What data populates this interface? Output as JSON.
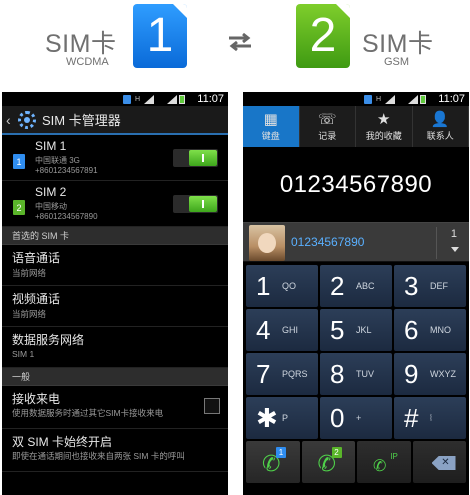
{
  "banner": {
    "left_sim": "SIM卡",
    "left_sub": "WCDMA",
    "card1": "1",
    "card2": "2",
    "right_sim": "SIM卡",
    "right_sub": "GSM"
  },
  "statusbar": {
    "time": "11:07",
    "net_label": "H"
  },
  "settings": {
    "title": "SIM 卡管理器",
    "sims": [
      {
        "badge": "1",
        "name": "SIM 1",
        "operator": "中国联通 3G",
        "number": "+8601234567891"
      },
      {
        "badge": "2",
        "name": "SIM 2",
        "operator": "中国移动",
        "number": "+8601234567890"
      }
    ],
    "preferred_header": "首选的 SIM 卡",
    "items": [
      {
        "title": "语音通话",
        "sub": "当前网络"
      },
      {
        "title": "视频通话",
        "sub": "当前网络"
      },
      {
        "title": "数据服务网络",
        "sub": "SIM 1"
      }
    ],
    "general_header": "一般",
    "receive": {
      "title": "接收来电",
      "sub": "使用数据服务时通过其它SIM卡接收来电"
    },
    "dual": {
      "title": "双 SIM 卡始终开启",
      "sub": "即使在通话期间也接收来自两张 SIM 卡的呼叫"
    }
  },
  "dialer": {
    "tabs": [
      {
        "icon": "keypad-icon",
        "label": "键盘"
      },
      {
        "icon": "call-log-icon",
        "label": "记录"
      },
      {
        "icon": "star-icon",
        "label": "我的收藏"
      },
      {
        "icon": "person-icon",
        "label": "联系人"
      }
    ],
    "display_number": "01234567890",
    "contact_number": "01234567890",
    "contact_count": "1",
    "keys": [
      {
        "digit": "1",
        "letters": "QO"
      },
      {
        "digit": "2",
        "letters": "ABC"
      },
      {
        "digit": "3",
        "letters": "DEF"
      },
      {
        "digit": "4",
        "letters": "GHI"
      },
      {
        "digit": "5",
        "letters": "JKL"
      },
      {
        "digit": "6",
        "letters": "MNO"
      },
      {
        "digit": "7",
        "letters": "PQRS"
      },
      {
        "digit": "8",
        "letters": "TUV"
      },
      {
        "digit": "9",
        "letters": "WXYZ"
      },
      {
        "digit": "✱",
        "letters": "P"
      },
      {
        "digit": "0",
        "letters": "+"
      },
      {
        "digit": "#",
        "letters": "⦚"
      }
    ],
    "actions": {
      "call1_badge": "1",
      "call2_badge": "2",
      "ip_label": "IP"
    },
    "colors": {
      "accent_blue": "#1876c8",
      "call_green": "#4fd14a",
      "sim1": "#2f8df0",
      "sim2": "#5ab52a"
    }
  }
}
